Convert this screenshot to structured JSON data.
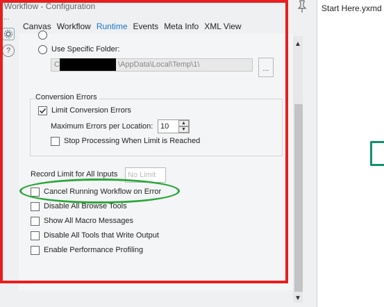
{
  "window": {
    "title": "Workflow - Configuration",
    "pin_icon": "pin-icon"
  },
  "tabs": [
    {
      "label": "Canvas",
      "active": false
    },
    {
      "label": "Workflow",
      "active": false
    },
    {
      "label": "Runtime",
      "active": true
    },
    {
      "label": "Events",
      "active": false
    },
    {
      "label": "Meta Info",
      "active": false
    },
    {
      "label": "XML View",
      "active": false
    }
  ],
  "side_icons": [
    "gear-icon",
    "help-icon"
  ],
  "temp_folder": {
    "use_specific_label": "Use Specific Folder:",
    "path_prefix": "C:",
    "path_suffix": "\\AppData\\Local\\Temp\\1\\",
    "browse_label": "..."
  },
  "conversion_errors": {
    "group_label": "Conversion Errors",
    "limit_label": "Limit Conversion Errors",
    "limit_checked": true,
    "max_label": "Maximum Errors per Location:",
    "max_value": "10",
    "stop_label": "Stop Processing When Limit is Reached",
    "stop_checked": false
  },
  "record_limit": {
    "label": "Record Limit for All Inputs",
    "placeholder": "No Limit"
  },
  "options": [
    {
      "label": "Cancel Running Workflow on Error",
      "checked": false
    },
    {
      "label": "Disable All Browse Tools",
      "checked": false
    },
    {
      "label": "Show All Macro Messages",
      "checked": false
    },
    {
      "label": "Disable All Tools that Write Output",
      "checked": false
    },
    {
      "label": "Enable Performance Profiling",
      "checked": false
    }
  ],
  "right_pane": {
    "file_tab": "Start Here.yxmd"
  },
  "colors": {
    "highlight_frame": "#e81e1e",
    "highlight_oval": "#2aa63a",
    "accent": "#1a73c8"
  }
}
